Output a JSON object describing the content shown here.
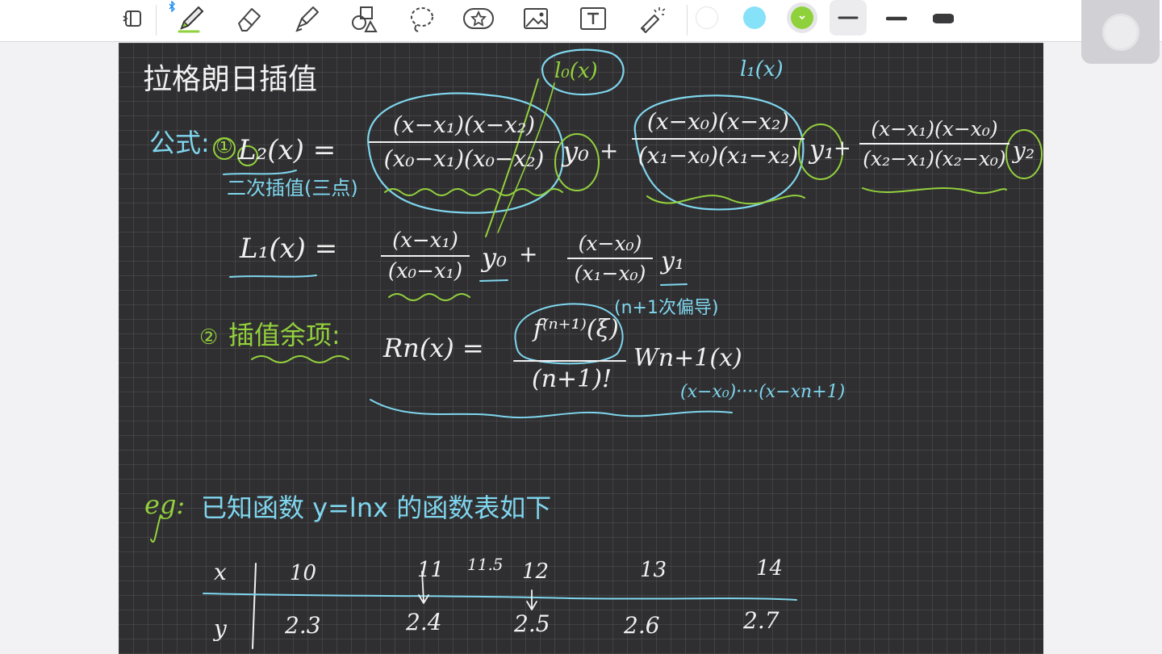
{
  "toolbar": {
    "tools": [
      {
        "name": "sidebar-toggle-icon",
        "selected": false
      },
      {
        "name": "pen-icon",
        "selected": true
      },
      {
        "name": "eraser-icon",
        "selected": false
      },
      {
        "name": "highlighter-icon",
        "selected": false
      },
      {
        "name": "shapes-icon",
        "selected": false
      },
      {
        "name": "lasso-icon",
        "selected": false
      },
      {
        "name": "sticker-icon",
        "selected": false
      },
      {
        "name": "image-icon",
        "selected": false
      },
      {
        "name": "text-icon",
        "selected": false
      },
      {
        "name": "laser-pointer-icon",
        "selected": false
      }
    ],
    "colors": [
      "#ffffff",
      "#86e2f8",
      "#8fd13a"
    ],
    "selected_color": "#8fd13a",
    "stroke_widths": [
      "thin",
      "medium",
      "thick"
    ],
    "selected_stroke": "thin"
  },
  "note": {
    "title": "拉格朗日插值",
    "formula_label": "公式:",
    "circle_one": "①",
    "l2_lhs": "L₂(x) =",
    "quadratic_note": "二次插值(三点)",
    "l0_label": "l₀(x)",
    "l1_label": "l₁(x)",
    "t1_num": "(x−x₁)(x−x₂)",
    "t1_den": "(x₀−x₁)(x₀−x₂)",
    "y0": "y₀",
    "plus": "+",
    "t2_num": "(x−x₀)(x−x₂)",
    "t2_den": "(x₁−x₀)(x₁−x₂)",
    "y1": "y₁",
    "t3_num": "(x−x₁)(x−x₀)",
    "t3_den": "(x₂−x₁)(x₂−x₀)",
    "y2": "y₂",
    "l1_lhs": "L₁(x) =",
    "lin_num1": "(x−x₁)",
    "lin_den1": "(x₀−x₁)",
    "lin_num2": "(x−x₀)",
    "lin_den2": "(x₁−x₀)",
    "circle_two": "②",
    "remainder_label": "插值余项:",
    "rn_lhs": "Rn(x) =",
    "rn_num": "f⁽ⁿ⁺¹⁾(ξ)",
    "rn_den": "(n+1)!",
    "omega": "Wn+1(x)",
    "derivative_note": "(n+1次偏导)",
    "omega_expansion": "(x−x₀)····(x−xn+1)",
    "eg_label": "eg:",
    "eg_text": "已知函数 y=lnx 的函数表如下",
    "table": {
      "x_label": "x",
      "y_label": "y",
      "x_values": [
        "10",
        "11",
        "12",
        "13",
        "14"
      ],
      "y_values": [
        "2.3",
        "2.4",
        "2.5",
        "2.6",
        "2.7"
      ],
      "target_x": "11.5"
    }
  }
}
